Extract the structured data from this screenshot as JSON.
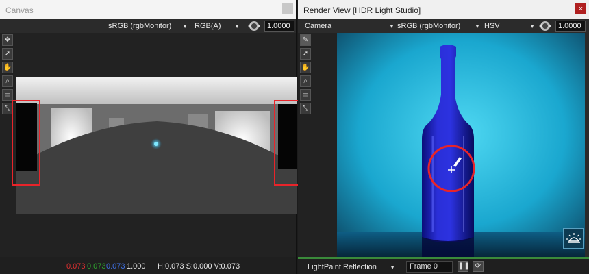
{
  "canvas_window": {
    "title": "Canvas",
    "color_space": "sRGB (rgbMonitor)",
    "channel": "RGB(A)",
    "exposure": "1.0000",
    "status": {
      "r": "0.073",
      "g": "0.073",
      "b": "0.073",
      "a": "1.000",
      "hsv": "H:0.073 S:0.000 V:0.073"
    }
  },
  "render_window": {
    "title": "Render View [HDR Light Studio]",
    "close_label": "×",
    "camera": "Camera",
    "color_space": "sRGB (rgbMonitor)",
    "mode": "HSV",
    "exposure": "1.0000",
    "light_mode": "LightPaint Reflection",
    "frame": "Frame 0"
  },
  "colors": {
    "highlight": "#e8242a",
    "accent_green": "#3a8a3a",
    "status_r": "#e03030",
    "status_g": "#2fa52f",
    "status_b": "#3f6fe0"
  },
  "icons": [
    "move-icon",
    "pointer-icon",
    "hand-icon",
    "zoom-icon",
    "region-icon",
    "fit-icon",
    "brush-icon",
    "exposure-icon",
    "light-bulb-icon",
    "pause-icon",
    "refresh-icon"
  ]
}
